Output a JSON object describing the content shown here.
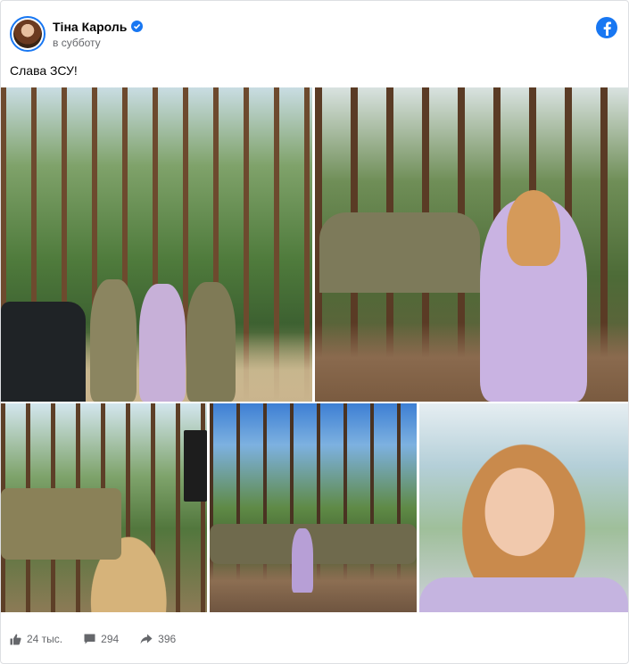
{
  "post": {
    "author": "Тіна Кароль",
    "timestamp": "в субботу",
    "text": "Слава ЗСУ!",
    "verified_icon": "verified-badge-icon",
    "brand_icon": "facebook-logo-icon",
    "brand_color": "#1877f2"
  },
  "photos": [
    {
      "name": "photo-group-soldiers"
    },
    {
      "name": "photo-singing-forest"
    },
    {
      "name": "photo-audience-view"
    },
    {
      "name": "photo-dancing-crowd"
    },
    {
      "name": "photo-selfie"
    }
  ],
  "stats": {
    "likes": "24 тыс.",
    "comments": "294",
    "shares": "396"
  }
}
